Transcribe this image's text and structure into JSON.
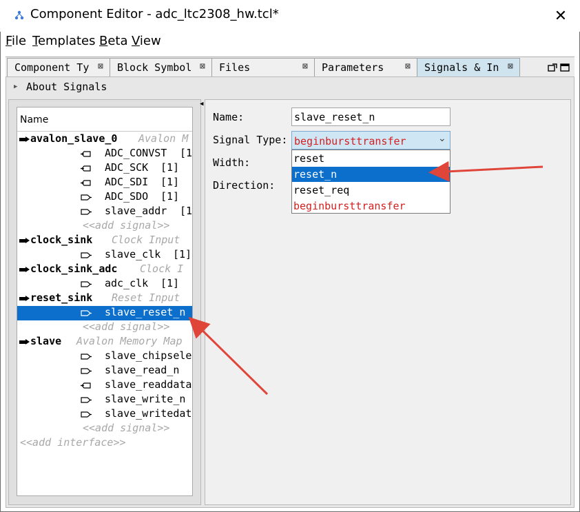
{
  "window": {
    "title": "Component Editor - adc_ltc2308_hw.tcl*",
    "close_glyph": "✕"
  },
  "menu": [
    {
      "underline": "F",
      "rest": "ile"
    },
    {
      "underline": "T",
      "rest": "emplates"
    },
    {
      "underline": "B",
      "rest": "eta"
    },
    {
      "underline": "V",
      "rest": "iew"
    }
  ],
  "tabs": [
    {
      "label": "Component Ty",
      "active": false
    },
    {
      "label": "Block Symbol",
      "active": false
    },
    {
      "label": "Files",
      "active": false
    },
    {
      "label": "Parameters",
      "active": false
    },
    {
      "label": "Signals & In",
      "active": true
    }
  ],
  "tab_close_glyph": "⊠",
  "about": "About Signals",
  "tree": {
    "header": "Name",
    "interfaces": [
      {
        "name": "avalon_slave_0",
        "type": "Avalon M",
        "signals": [
          {
            "name": "ADC_CONVST",
            "width": "[1",
            "dir": "out"
          },
          {
            "name": "ADC_SCK",
            "width": "[1]",
            "dir": "out"
          },
          {
            "name": "ADC_SDI",
            "width": "[1]",
            "dir": "out"
          },
          {
            "name": "ADC_SDO",
            "width": "[1]",
            "dir": "in"
          },
          {
            "name": "slave_addr",
            "width": "[1",
            "dir": "in"
          }
        ]
      },
      {
        "name": "clock_sink",
        "type": "Clock Input",
        "signals": [
          {
            "name": "slave_clk",
            "width": "[1]",
            "dir": "in"
          }
        ]
      },
      {
        "name": "clock_sink_adc",
        "type": "Clock I",
        "signals": [
          {
            "name": "adc_clk",
            "width": "[1]",
            "dir": "in"
          }
        ]
      },
      {
        "name": "reset_sink",
        "type": "Reset Input",
        "signals": [
          {
            "name": "slave_reset_n",
            "width": "",
            "dir": "in",
            "selected": true
          }
        ]
      },
      {
        "name": "slave",
        "type": "Avalon Memory Map",
        "signals": [
          {
            "name": "slave_chipselec",
            "width": "",
            "dir": "in"
          },
          {
            "name": "slave_read_n",
            "width": "",
            "dir": "in"
          },
          {
            "name": "slave_readdata",
            "width": "",
            "dir": "out"
          },
          {
            "name": "slave_write_n",
            "width": "",
            "dir": "in"
          },
          {
            "name": "slave_writedata",
            "width": "",
            "dir": "in"
          }
        ]
      }
    ],
    "add_signal": "<<add signal>>",
    "add_interface": "<<add interface>>"
  },
  "props": {
    "name_label": "Name:",
    "name_value": "slave_reset_n",
    "type_label": "Signal Type:",
    "type_value": "beginbursttransfer",
    "width_label": "Width:",
    "direction_label": "Direction:",
    "dropdown_options": [
      {
        "label": "reset",
        "selected": false,
        "red": false
      },
      {
        "label": "reset_n",
        "selected": true,
        "red": false
      },
      {
        "label": "reset_req",
        "selected": false,
        "red": false
      },
      {
        "label": "beginbursttransfer",
        "selected": false,
        "red": true
      }
    ]
  },
  "colors": {
    "selection": "#0b6fcb",
    "annotation_arrow": "#e0453a",
    "invalid_text": "#d51f1f"
  }
}
